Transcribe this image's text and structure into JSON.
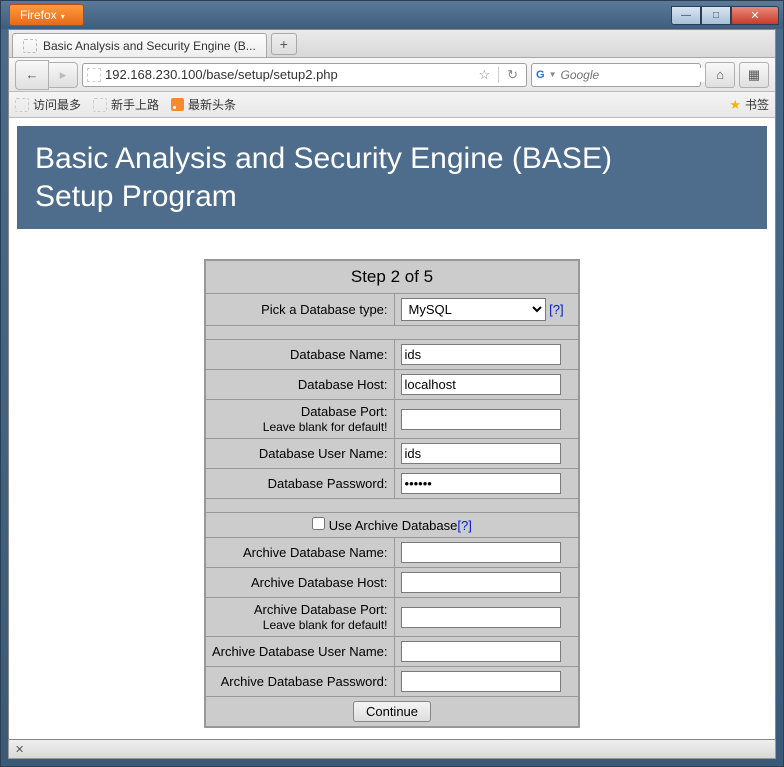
{
  "window": {
    "app_menu": "Firefox",
    "controls": {
      "min": "—",
      "max": "□",
      "close": "✕"
    }
  },
  "tabs": {
    "active": {
      "title": "Basic Analysis and Security Engine (B..."
    },
    "new_symbol": "+"
  },
  "navbar": {
    "back": "←",
    "forward": "▸",
    "url": "192.168.230.100/base/setup/setup2.php",
    "star": "☆",
    "reload": "↻",
    "search_placeholder": "Google",
    "home": "⌂",
    "addons": "▦"
  },
  "bookmarks": {
    "items": [
      "访问最多",
      "新手上路",
      "最新头条"
    ],
    "label": "书签"
  },
  "page": {
    "hero_line1": "Basic Analysis and Security Engine (BASE)",
    "hero_line2": "Setup Program",
    "step_header": "Step 2 of 5",
    "labels": {
      "db_type": "Pick a Database type:",
      "db_name": "Database Name:",
      "db_host": "Database Host:",
      "db_port": "Database Port:",
      "db_port_sub": "Leave blank for default!",
      "db_user": "Database User Name:",
      "db_pass": "Database Password:",
      "use_archive": "Use Archive Database",
      "a_db_name": "Archive Database Name:",
      "a_db_host": "Archive Database Host:",
      "a_db_port": "Archive Database Port:",
      "a_db_port_sub": "Leave blank for default!",
      "a_db_user": "Archive Database User Name:",
      "a_db_pass": "Archive Database Password:",
      "help": "[?]"
    },
    "values": {
      "db_type": "MySQL",
      "db_name": "ids",
      "db_host": "localhost",
      "db_port": "",
      "db_user": "ids",
      "db_pass": "••••••",
      "use_archive": false,
      "a_db_name": "",
      "a_db_host": "",
      "a_db_port": "",
      "a_db_user": "",
      "a_db_pass": ""
    },
    "continue": "Continue"
  },
  "statusbar": {
    "text": "✕"
  }
}
